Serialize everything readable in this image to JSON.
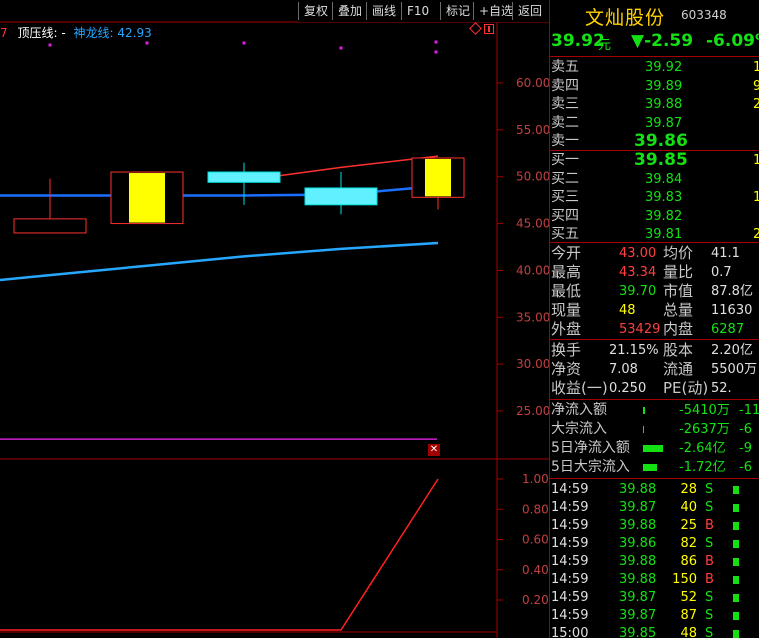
{
  "toolbar": {
    "buttons": [
      "复权",
      "叠加",
      "画线",
      "F10",
      "标记",
      "+自选",
      "返回"
    ]
  },
  "indicator_line": {
    "prefix": "7",
    "label1": "顶压线: -",
    "label2": "神龙线: 42.93"
  },
  "stock": {
    "name": "文灿股份",
    "code": "603348",
    "price": "39.92",
    "price_unit": "元",
    "change": "▼-2.59",
    "change_pct": "-6.09%"
  },
  "asks": [
    {
      "label": "卖五",
      "price": "39.92",
      "vol": "1"
    },
    {
      "label": "卖四",
      "price": "39.89",
      "vol": "9"
    },
    {
      "label": "卖三",
      "price": "39.88",
      "vol": "2"
    },
    {
      "label": "卖二",
      "price": "39.87",
      "vol": ""
    },
    {
      "label": "卖一",
      "price": "39.86",
      "vol": ""
    }
  ],
  "bids": [
    {
      "label": "买一",
      "price": "39.85",
      "vol": "1"
    },
    {
      "label": "买二",
      "price": "39.84",
      "vol": ""
    },
    {
      "label": "买三",
      "price": "39.83",
      "vol": "1"
    },
    {
      "label": "买四",
      "price": "39.82",
      "vol": ""
    },
    {
      "label": "买五",
      "price": "39.81",
      "vol": "2"
    }
  ],
  "stats1": [
    {
      "l1": "今开",
      "v1": "43.00",
      "l2": "均价",
      "v2": "41.1"
    },
    {
      "l1": "最高",
      "v1": "43.34",
      "l2": "量比",
      "v2": "0.7"
    },
    {
      "l1": "最低",
      "v1": "39.70",
      "l2": "市值",
      "v2": "87.8亿"
    },
    {
      "l1": "现量",
      "v1": "48",
      "l2": "总量",
      "v2": "11630"
    },
    {
      "l1": "外盘",
      "v1": "53429",
      "l2": "内盘",
      "v2": "6287"
    }
  ],
  "stats2": [
    {
      "l1": "换手",
      "v1": "21.15%",
      "l2": "股本",
      "v2": "2.20亿"
    },
    {
      "l1": "净资",
      "v1": "7.08",
      "l2": "流通",
      "v2": "5500万"
    },
    {
      "l1": "收益(一)",
      "v1": "0.250",
      "l2": "PE(动)",
      "v2": "52."
    }
  ],
  "flows": [
    {
      "label": "净流入额",
      "value": "-5410万",
      "extra": "-11"
    },
    {
      "label": "大宗流入",
      "value": "-2637万",
      "extra": "-6"
    },
    {
      "label": "5日净流入额",
      "value": "-2.64亿",
      "extra": "-9"
    },
    {
      "label": "5日大宗流入",
      "value": "-1.72亿",
      "extra": "-6"
    }
  ],
  "ticks": [
    {
      "time": "14:59",
      "price": "39.88",
      "vol": "28",
      "side": "S"
    },
    {
      "time": "14:59",
      "price": "39.87",
      "vol": "40",
      "side": "S"
    },
    {
      "time": "14:59",
      "price": "39.88",
      "vol": "25",
      "side": "B"
    },
    {
      "time": "14:59",
      "price": "39.86",
      "vol": "82",
      "side": "S"
    },
    {
      "time": "14:59",
      "price": "39.88",
      "vol": "86",
      "side": "B"
    },
    {
      "time": "14:59",
      "price": "39.88",
      "vol": "150",
      "side": "B"
    },
    {
      "time": "14:59",
      "price": "39.87",
      "vol": "52",
      "side": "S"
    },
    {
      "time": "14:59",
      "price": "39.87",
      "vol": "87",
      "side": "S"
    },
    {
      "time": "15:00",
      "price": "39.85",
      "vol": "48",
      "side": "S"
    }
  ],
  "chart_data": [
    {
      "type": "candlestick",
      "ylim": [
        20,
        65
      ],
      "yticks": [
        "60.00",
        "55.00",
        "50.00",
        "45.00",
        "40.00",
        "35.00",
        "30.00",
        "25.00"
      ],
      "candles": [
        {
          "open": 44.0,
          "close": 45.5,
          "high": 49.8,
          "low": 44.0,
          "color": "red-hollow"
        },
        {
          "open": 45.0,
          "close": 50.5,
          "high": 50.5,
          "low": 45.0,
          "color": "red-hollow-yellow"
        },
        {
          "open": 50.5,
          "close": 49.4,
          "high": 51.5,
          "low": 47.0,
          "color": "cyan"
        },
        {
          "open": 48.8,
          "close": 47.0,
          "high": 50.5,
          "low": 46.0,
          "color": "cyan"
        },
        {
          "open": 47.8,
          "close": 52.0,
          "high": 52.0,
          "low": 46.5,
          "color": "red-hollow-yellow"
        }
      ],
      "series": [
        {
          "name": "神龙线",
          "values": [
            39.5,
            40.5,
            41.5,
            42.3,
            42.93
          ],
          "color": "#27a7ff"
        },
        {
          "name": "均线",
          "values": [
            48.0,
            48.0,
            48.0,
            48.1,
            49.0
          ],
          "color": "#1c70ff"
        },
        {
          "name": "顶压线",
          "values": [
            null,
            null,
            49.6,
            51.0,
            52.2
          ],
          "color": "#ff3030"
        }
      ],
      "magenta_level": 22.0
    },
    {
      "type": "line",
      "ylim": [
        0,
        1.1
      ],
      "yticks": [
        "1.00",
        "0.80",
        "0.60",
        "0.40",
        "0.20"
      ],
      "x": [
        0,
        1,
        2,
        3,
        4,
        5
      ],
      "values": [
        0,
        0,
        0,
        0,
        0,
        1.0
      ]
    }
  ],
  "colors": {
    "up": "#ff3030",
    "down": "#00e0e0",
    "fill": "#ffff00",
    "bg": "#000000"
  }
}
